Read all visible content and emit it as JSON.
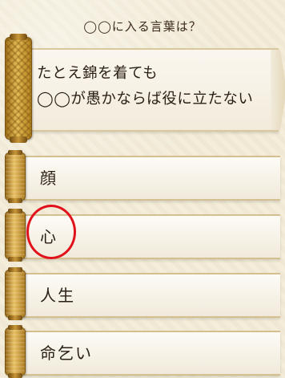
{
  "instruction": "◯◯に入る言葉は？",
  "question": {
    "lines": [
      "たとえ錦を着ても",
      "◯◯が愚かならば役に立たない"
    ]
  },
  "answers": [
    {
      "label": "顔"
    },
    {
      "label": "心",
      "circled": true
    },
    {
      "label": "人生"
    },
    {
      "label": "命乞い"
    }
  ],
  "colors": {
    "gold": "#e5bc57",
    "marker": "#e0121b",
    "background": "#f3ecd9"
  },
  "icons": [
    "scroll-roller-icon"
  ]
}
